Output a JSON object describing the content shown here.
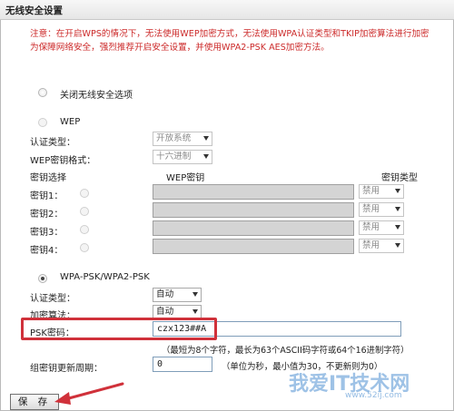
{
  "window": {
    "title": "无线安全设置"
  },
  "notice": "注意：在开启WPS的情况下，无法使用WEP加密方式，无法使用WPA认证类型和TKIP加密算法进行加密为保障网络安全，强烈推荐开启安全设置，并使用WPA2-PSK AES加密方法。",
  "disable_option": {
    "label": "关闭无线安全选项"
  },
  "wep": {
    "label": "WEP",
    "auth_type_label": "认证类型：",
    "auth_type_value": "开放系统",
    "key_format_label": "WEP密钥格式：",
    "key_format_value": "十六进制",
    "key_select_header": "密钥选择",
    "key_header": "WEP密钥",
    "key_type_header": "密钥类型",
    "keys": [
      {
        "label": "密钥1：",
        "type": "禁用"
      },
      {
        "label": "密钥2：",
        "type": "禁用"
      },
      {
        "label": "密钥3：",
        "type": "禁用"
      },
      {
        "label": "密钥4：",
        "type": "禁用"
      }
    ]
  },
  "wpa": {
    "label": "WPA-PSK/WPA2-PSK",
    "auth_type_label": "认证类型：",
    "auth_type_value": "自动",
    "encryption_label": "加密算法：",
    "encryption_value": "自动",
    "psk_label": "PSK密码：",
    "psk_value": "czx123##A",
    "psk_hint": "（最短为8个字符，最长为63个ASCII码字符或64个16进制字符）",
    "rekey_label": "组密钥更新周期：",
    "rekey_value": "0",
    "rekey_hint": "（单位为秒，最小值为30，不更新则为0）"
  },
  "save_button": "保 存",
  "watermark": {
    "main": "我爱IT技术网",
    "sub": "www.52ij.com"
  },
  "colors": {
    "notice": "#cc2a2a",
    "highlight": "#d0313a"
  }
}
